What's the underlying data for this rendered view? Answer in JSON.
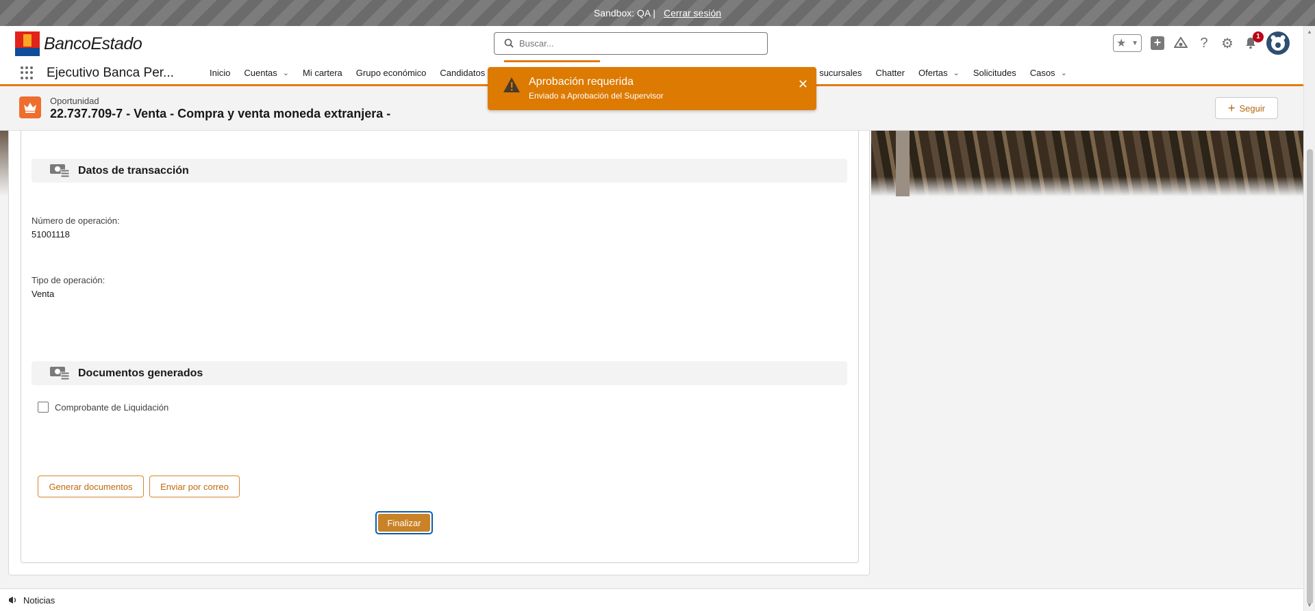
{
  "sandbox": {
    "label": "Sandbox: QA |",
    "logout": "Cerrar sesión"
  },
  "logo": {
    "text": "BancoEstado"
  },
  "search": {
    "placeholder": "Buscar..."
  },
  "header": {
    "notification_count": "1"
  },
  "nav": {
    "app_name": "Ejecutivo Banca Per...",
    "items": [
      {
        "label": "Inicio",
        "has_menu": false
      },
      {
        "label": "Cuentas",
        "has_menu": true
      },
      {
        "label": "Mi cartera",
        "has_menu": false
      },
      {
        "label": "Grupo económico",
        "has_menu": false
      },
      {
        "label": "Candidatos",
        "has_menu": false
      },
      {
        "label": "sucursales",
        "has_menu": false
      },
      {
        "label": "Chatter",
        "has_menu": false
      },
      {
        "label": "Ofertas",
        "has_menu": true
      },
      {
        "label": "Solicitudes",
        "has_menu": false
      },
      {
        "label": "Casos",
        "has_menu": true
      }
    ]
  },
  "record": {
    "type": "Oportunidad",
    "title": "22.737.709-7 - Venta - Compra y venta moneda extranjera -",
    "follow_label": "Seguir"
  },
  "toast": {
    "title": "Aprobación requerida",
    "message": "Enviado a Aprobación del Supervisor",
    "color": "#dd7a01"
  },
  "transaction": {
    "section_title": "Datos de transacción",
    "operation_number_label": "Número de operación:",
    "operation_number": "51001118",
    "operation_type_label": "Tipo de operación:",
    "operation_type": "Venta"
  },
  "documents": {
    "section_title": "Documentos generados",
    "items": [
      {
        "label": "Comprobante de Liquidación",
        "checked": false
      }
    ]
  },
  "actions": {
    "generate_label": "Generar documentos",
    "email_label": "Enviar por correo",
    "finish_label": "Finalizar"
  },
  "footer": {
    "label": "Noticias"
  },
  "colors": {
    "accent": "#e27a10",
    "brand_orange": "#c98226",
    "focus_blue": "#0b5cab"
  }
}
